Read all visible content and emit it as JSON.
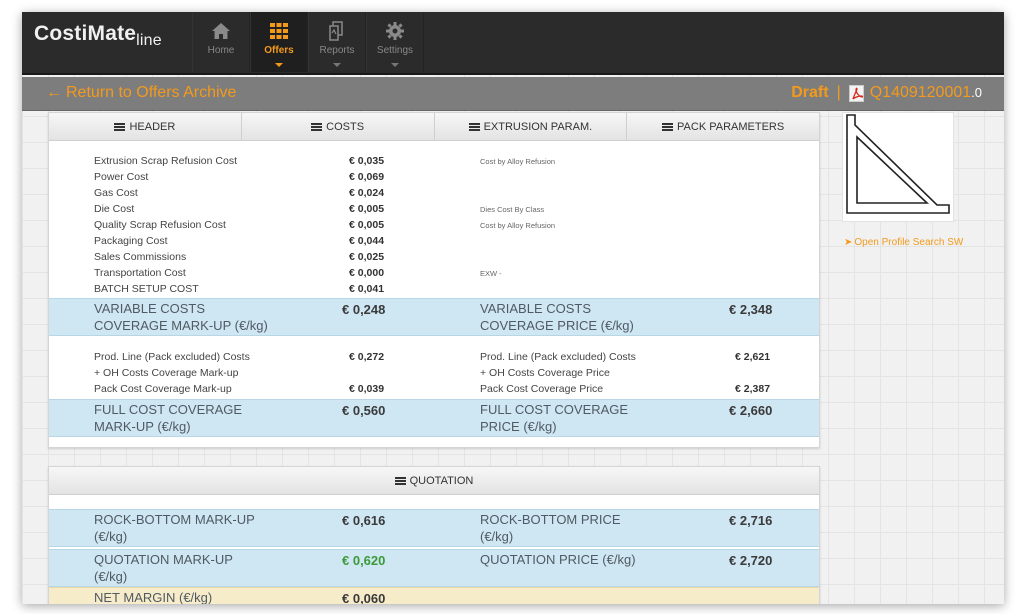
{
  "app": {
    "logo_main": "CostiMate",
    "logo_sub": "line"
  },
  "nav": [
    {
      "label": "Home",
      "icon": "home-icon",
      "active": false
    },
    {
      "label": "Offers",
      "icon": "grid-icon",
      "active": true
    },
    {
      "label": "Reports",
      "icon": "reports-icon",
      "active": false
    },
    {
      "label": "Settings",
      "icon": "gear-icon",
      "active": false
    }
  ],
  "subbar": {
    "back_label": "Return to Offers Archive",
    "status": "Draft",
    "separator": "|",
    "offer_number": "Q1409120001",
    "offer_version": ".0"
  },
  "tabs": [
    "HEADER",
    "COSTS",
    "EXTRUSION PARAM.",
    "PACK PARAMETERS"
  ],
  "costs": [
    {
      "label": "Extrusion Scrap Refusion Cost",
      "value": "€ 0,035",
      "note": "Cost by Alloy Refusion"
    },
    {
      "label": "Power Cost",
      "value": "€ 0,069",
      "note": ""
    },
    {
      "label": "Gas Cost",
      "value": "€ 0,024",
      "note": ""
    },
    {
      "label": "Die Cost",
      "value": "€ 0,005",
      "note": "Dies Cost By Class"
    },
    {
      "label": "Quality Scrap Refusion Cost",
      "value": "€ 0,005",
      "note": "Cost by Alloy Refusion"
    },
    {
      "label": "Packaging Cost",
      "value": "€ 0,044",
      "note": ""
    },
    {
      "label": "Sales Commissions",
      "value": "€ 0,025",
      "note": ""
    },
    {
      "label": "Transportation Cost",
      "value": "€ 0,000",
      "note": "EXW -"
    },
    {
      "label": "BATCH SETUP COST",
      "value": "€ 0,041",
      "note": ""
    }
  ],
  "variable_band": {
    "left_label_1": "VARIABLE COSTS",
    "left_label_2": "COVERAGE MARK-UP (€/kg)",
    "left_value": "€ 0,248",
    "right_label_1": "VARIABLE COSTS",
    "right_label_2": "COVERAGE PRICE (€/kg)",
    "right_value": "€ 2,348"
  },
  "mid": {
    "l1": "Prod. Line (Pack excluded) Costs",
    "l2": "+ OH Costs Coverage Mark-up",
    "l3": "Pack Cost Coverage Mark-up",
    "v1": "€ 0,272",
    "v3": "€ 0,039",
    "r1": "Prod. Line (Pack excluded) Costs",
    "r2": "+ OH Costs Coverage Price",
    "r3": "Pack Cost Coverage Price",
    "rv1": "€ 2,621",
    "rv3": "€ 2,387"
  },
  "full_band": {
    "left_label_1": "FULL COST COVERAGE",
    "left_label_2": "MARK-UP (€/kg)",
    "left_value": "€ 0,560",
    "right_label_1": "FULL COST COVERAGE",
    "right_label_2": "PRICE (€/kg)",
    "right_value": "€ 2,660"
  },
  "profile": {
    "link_label": "Open Profile Search SW"
  },
  "quotation": {
    "tab_label": "QUOTATION",
    "rock_left_1": "ROCK-BOTTOM MARK-UP",
    "rock_left_2": "(€/kg)",
    "rock_left_value": "€ 0,616",
    "rock_right": "ROCK-BOTTOM PRICE",
    "rock_right_2": "(€/kg)",
    "rock_right_value": "€ 2,716",
    "quote_left_1": "QUOTATION MARK-UP",
    "quote_left_2": "(€/kg)",
    "quote_left_value": "€ 0,620",
    "quote_right": "QUOTATION PRICE (€/kg)",
    "quote_right_value": "€ 2,720",
    "net_label": "NET MARGIN (€/kg)",
    "net_value": "€ 0,060"
  },
  "colors": {
    "accent": "#f39a1d",
    "band_blue": "#cfe6f3",
    "band_yellow": "#f7ecc9",
    "positive_green": "#3a9a3a"
  }
}
